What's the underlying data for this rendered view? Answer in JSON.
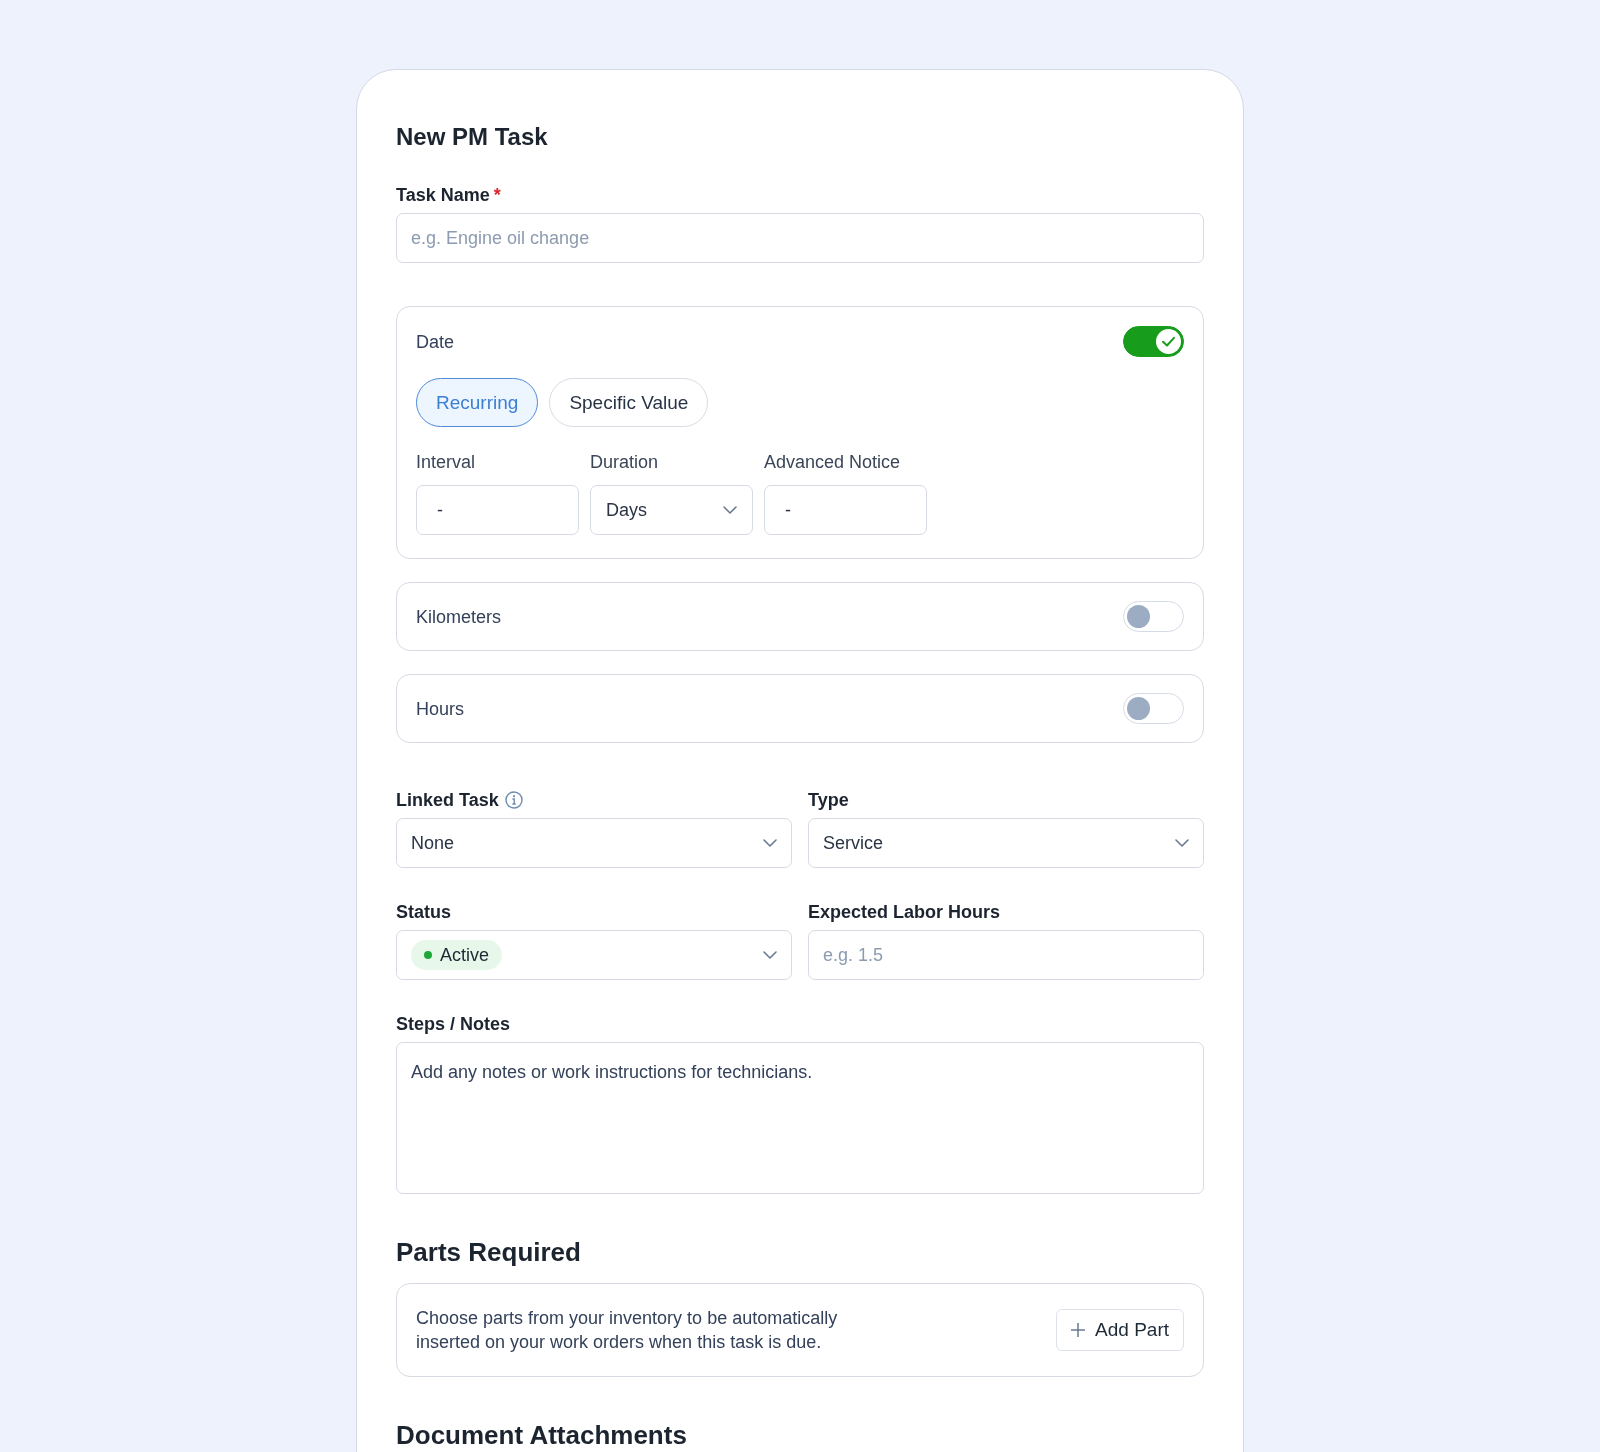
{
  "form": {
    "title": "New PM Task"
  },
  "task_name": {
    "label": "Task Name",
    "required_mark": "*",
    "placeholder": "e.g. Engine oil change"
  },
  "triggers": [
    {
      "label": "Date",
      "on": true,
      "modes": [
        {
          "label": "Recurring",
          "selected": true
        },
        {
          "label": "Specific Value",
          "selected": false
        }
      ],
      "fields": [
        {
          "kind": "input",
          "label": "Interval",
          "value": "-"
        },
        {
          "kind": "select",
          "label": "Duration",
          "value": "Days"
        },
        {
          "kind": "input",
          "label": "Advanced Notice",
          "value": "-"
        }
      ]
    },
    {
      "label": "Kilometers",
      "on": false
    },
    {
      "label": "Hours",
      "on": false
    }
  ],
  "fields": [
    {
      "kind": "select",
      "label": "Linked Task",
      "info": true,
      "value": "None"
    },
    {
      "kind": "select",
      "label": "Type",
      "info": false,
      "value": "Service"
    },
    {
      "kind": "status",
      "label": "Status",
      "info": false,
      "value": "Active"
    },
    {
      "kind": "input",
      "label": "Expected Labor Hours",
      "info": false,
      "placeholder": "e.g. 1.5"
    }
  ],
  "notes": {
    "label": "Steps / Notes",
    "value": "Add any notes or work instructions for technicians."
  },
  "parts": {
    "heading": "Parts Required",
    "description": "Choose parts from your inventory to be automatically inserted on your work orders when this task is due.",
    "button": "Add Part"
  },
  "attachments": {
    "heading": "Document Attachments"
  }
}
